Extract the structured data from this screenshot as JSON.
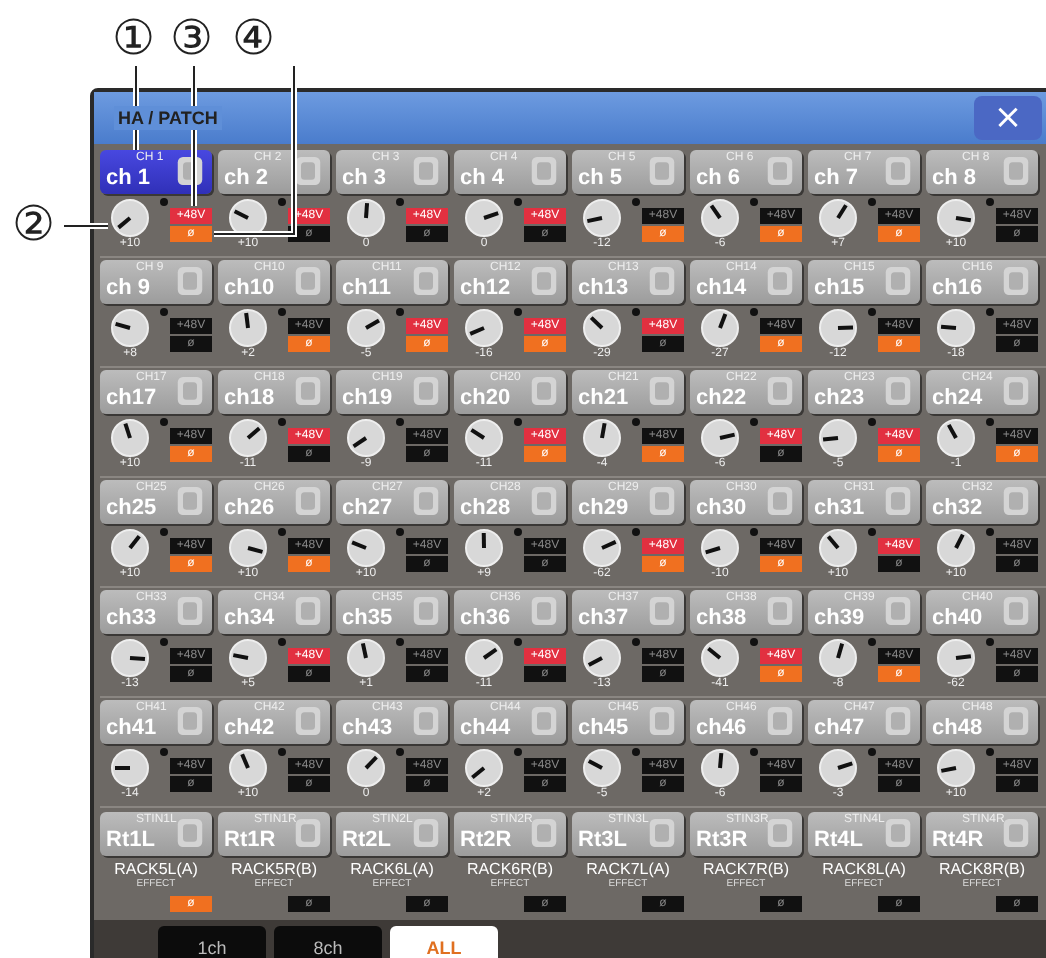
{
  "callouts": [
    {
      "label": "①"
    },
    {
      "label": "②"
    },
    {
      "label": "③"
    },
    {
      "label": "④"
    }
  ],
  "window": {
    "title": "HA / PATCH",
    "close": "×"
  },
  "groups": [
    {
      "channels": [
        {
          "label": "CH 1",
          "name": "ch 1",
          "selected": true,
          "gain": "+10",
          "phantom": true,
          "phantom_label": "+48V",
          "phase": true,
          "phase_label": "ø"
        },
        {
          "label": "CH 2",
          "name": "ch 2",
          "selected": false,
          "gain": "+10",
          "phantom": true,
          "phantom_label": "+48V",
          "phase": false,
          "phase_label": "ø"
        },
        {
          "label": "CH 3",
          "name": "ch 3",
          "selected": false,
          "gain": "0",
          "phantom": true,
          "phantom_label": "+48V",
          "phase": false,
          "phase_label": "ø"
        },
        {
          "label": "CH 4",
          "name": "ch 4",
          "selected": false,
          "gain": "0",
          "phantom": true,
          "phantom_label": "+48V",
          "phase": false,
          "phase_label": "ø"
        },
        {
          "label": "CH 5",
          "name": "ch 5",
          "selected": false,
          "gain": "-12",
          "phantom": false,
          "phantom_label": "+48V",
          "phase": true,
          "phase_label": "ø"
        },
        {
          "label": "CH 6",
          "name": "ch 6",
          "selected": false,
          "gain": "-6",
          "phantom": false,
          "phantom_label": "+48V",
          "phase": true,
          "phase_label": "ø"
        },
        {
          "label": "CH 7",
          "name": "ch 7",
          "selected": false,
          "gain": "+7",
          "phantom": false,
          "phantom_label": "+48V",
          "phase": true,
          "phase_label": "ø"
        },
        {
          "label": "CH 8",
          "name": "ch 8",
          "selected": false,
          "gain": "+10",
          "phantom": false,
          "phantom_label": "+48V",
          "phase": false,
          "phase_label": "ø"
        }
      ]
    },
    {
      "channels": [
        {
          "label": "CH 9",
          "name": "ch 9",
          "selected": false,
          "gain": "+8",
          "phantom": false,
          "phantom_label": "+48V",
          "phase": false,
          "phase_label": "ø"
        },
        {
          "label": "CH10",
          "name": "ch10",
          "selected": false,
          "gain": "+2",
          "phantom": false,
          "phantom_label": "+48V",
          "phase": true,
          "phase_label": "ø"
        },
        {
          "label": "CH11",
          "name": "ch11",
          "selected": false,
          "gain": "-5",
          "phantom": true,
          "phantom_label": "+48V",
          "phase": true,
          "phase_label": "ø"
        },
        {
          "label": "CH12",
          "name": "ch12",
          "selected": false,
          "gain": "-16",
          "phantom": true,
          "phantom_label": "+48V",
          "phase": true,
          "phase_label": "ø"
        },
        {
          "label": "CH13",
          "name": "ch13",
          "selected": false,
          "gain": "-29",
          "phantom": true,
          "phantom_label": "+48V",
          "phase": false,
          "phase_label": "ø"
        },
        {
          "label": "CH14",
          "name": "ch14",
          "selected": false,
          "gain": "-27",
          "phantom": false,
          "phantom_label": "+48V",
          "phase": true,
          "phase_label": "ø"
        },
        {
          "label": "CH15",
          "name": "ch15",
          "selected": false,
          "gain": "-12",
          "phantom": false,
          "phantom_label": "+48V",
          "phase": true,
          "phase_label": "ø"
        },
        {
          "label": "CH16",
          "name": "ch16",
          "selected": false,
          "gain": "-18",
          "phantom": false,
          "phantom_label": "+48V",
          "phase": false,
          "phase_label": "ø"
        }
      ]
    },
    {
      "channels": [
        {
          "label": "CH17",
          "name": "ch17",
          "selected": false,
          "gain": "+10",
          "phantom": false,
          "phantom_label": "+48V",
          "phase": true,
          "phase_label": "ø"
        },
        {
          "label": "CH18",
          "name": "ch18",
          "selected": false,
          "gain": "-11",
          "phantom": true,
          "phantom_label": "+48V",
          "phase": false,
          "phase_label": "ø"
        },
        {
          "label": "CH19",
          "name": "ch19",
          "selected": false,
          "gain": "-9",
          "phantom": false,
          "phantom_label": "+48V",
          "phase": false,
          "phase_label": "ø"
        },
        {
          "label": "CH20",
          "name": "ch20",
          "selected": false,
          "gain": "-11",
          "phantom": true,
          "phantom_label": "+48V",
          "phase": true,
          "phase_label": "ø"
        },
        {
          "label": "CH21",
          "name": "ch21",
          "selected": false,
          "gain": "-4",
          "phantom": false,
          "phantom_label": "+48V",
          "phase": true,
          "phase_label": "ø"
        },
        {
          "label": "CH22",
          "name": "ch22",
          "selected": false,
          "gain": "-6",
          "phantom": true,
          "phantom_label": "+48V",
          "phase": false,
          "phase_label": "ø"
        },
        {
          "label": "CH23",
          "name": "ch23",
          "selected": false,
          "gain": "-5",
          "phantom": true,
          "phantom_label": "+48V",
          "phase": true,
          "phase_label": "ø"
        },
        {
          "label": "CH24",
          "name": "ch24",
          "selected": false,
          "gain": "-1",
          "phantom": false,
          "phantom_label": "+48V",
          "phase": true,
          "phase_label": "ø"
        }
      ]
    },
    {
      "channels": [
        {
          "label": "CH25",
          "name": "ch25",
          "selected": false,
          "gain": "+10",
          "phantom": false,
          "phantom_label": "+48V",
          "phase": true,
          "phase_label": "ø"
        },
        {
          "label": "CH26",
          "name": "ch26",
          "selected": false,
          "gain": "+10",
          "phantom": false,
          "phantom_label": "+48V",
          "phase": true,
          "phase_label": "ø"
        },
        {
          "label": "CH27",
          "name": "ch27",
          "selected": false,
          "gain": "+10",
          "phantom": false,
          "phantom_label": "+48V",
          "phase": false,
          "phase_label": "ø"
        },
        {
          "label": "CH28",
          "name": "ch28",
          "selected": false,
          "gain": "+9",
          "phantom": false,
          "phantom_label": "+48V",
          "phase": false,
          "phase_label": "ø"
        },
        {
          "label": "CH29",
          "name": "ch29",
          "selected": false,
          "gain": "-62",
          "phantom": true,
          "phantom_label": "+48V",
          "phase": true,
          "phase_label": "ø"
        },
        {
          "label": "CH30",
          "name": "ch30",
          "selected": false,
          "gain": "-10",
          "phantom": false,
          "phantom_label": "+48V",
          "phase": true,
          "phase_label": "ø"
        },
        {
          "label": "CH31",
          "name": "ch31",
          "selected": false,
          "gain": "+10",
          "phantom": true,
          "phantom_label": "+48V",
          "phase": false,
          "phase_label": "ø"
        },
        {
          "label": "CH32",
          "name": "ch32",
          "selected": false,
          "gain": "+10",
          "phantom": false,
          "phantom_label": "+48V",
          "phase": false,
          "phase_label": "ø"
        }
      ]
    },
    {
      "channels": [
        {
          "label": "CH33",
          "name": "ch33",
          "selected": false,
          "gain": "-13",
          "phantom": false,
          "phantom_label": "+48V",
          "phase": false,
          "phase_label": "ø"
        },
        {
          "label": "CH34",
          "name": "ch34",
          "selected": false,
          "gain": "+5",
          "phantom": true,
          "phantom_label": "+48V",
          "phase": false,
          "phase_label": "ø"
        },
        {
          "label": "CH35",
          "name": "ch35",
          "selected": false,
          "gain": "+1",
          "phantom": false,
          "phantom_label": "+48V",
          "phase": false,
          "phase_label": "ø"
        },
        {
          "label": "CH36",
          "name": "ch36",
          "selected": false,
          "gain": "-11",
          "phantom": true,
          "phantom_label": "+48V",
          "phase": false,
          "phase_label": "ø"
        },
        {
          "label": "CH37",
          "name": "ch37",
          "selected": false,
          "gain": "-13",
          "phantom": false,
          "phantom_label": "+48V",
          "phase": false,
          "phase_label": "ø"
        },
        {
          "label": "CH38",
          "name": "ch38",
          "selected": false,
          "gain": "-41",
          "phantom": true,
          "phantom_label": "+48V",
          "phase": true,
          "phase_label": "ø"
        },
        {
          "label": "CH39",
          "name": "ch39",
          "selected": false,
          "gain": "-8",
          "phantom": false,
          "phantom_label": "+48V",
          "phase": true,
          "phase_label": "ø"
        },
        {
          "label": "CH40",
          "name": "ch40",
          "selected": false,
          "gain": "-62",
          "phantom": false,
          "phantom_label": "+48V",
          "phase": false,
          "phase_label": "ø"
        }
      ]
    },
    {
      "channels": [
        {
          "label": "CH41",
          "name": "ch41",
          "selected": false,
          "gain": "-14",
          "phantom": false,
          "phantom_label": "+48V",
          "phase": false,
          "phase_label": "ø"
        },
        {
          "label": "CH42",
          "name": "ch42",
          "selected": false,
          "gain": "+10",
          "phantom": false,
          "phantom_label": "+48V",
          "phase": false,
          "phase_label": "ø"
        },
        {
          "label": "CH43",
          "name": "ch43",
          "selected": false,
          "gain": "0",
          "phantom": false,
          "phantom_label": "+48V",
          "phase": false,
          "phase_label": "ø"
        },
        {
          "label": "CH44",
          "name": "ch44",
          "selected": false,
          "gain": "+2",
          "phantom": false,
          "phantom_label": "+48V",
          "phase": false,
          "phase_label": "ø"
        },
        {
          "label": "CH45",
          "name": "ch45",
          "selected": false,
          "gain": "-5",
          "phantom": false,
          "phantom_label": "+48V",
          "phase": false,
          "phase_label": "ø"
        },
        {
          "label": "CH46",
          "name": "ch46",
          "selected": false,
          "gain": "-6",
          "phantom": false,
          "phantom_label": "+48V",
          "phase": false,
          "phase_label": "ø"
        },
        {
          "label": "CH47",
          "name": "ch47",
          "selected": false,
          "gain": "-3",
          "phantom": false,
          "phantom_label": "+48V",
          "phase": false,
          "phase_label": "ø"
        },
        {
          "label": "CH48",
          "name": "ch48",
          "selected": false,
          "gain": "+10",
          "phantom": false,
          "phantom_label": "+48V",
          "phase": false,
          "phase_label": "ø"
        }
      ]
    }
  ],
  "stereo_inputs": [
    {
      "label": "STIN1L",
      "name": "Rt1L",
      "selected": false,
      "rack": "RACK5L(A)",
      "type": "EFFECT",
      "phase": true,
      "phase_label": "ø"
    },
    {
      "label": "STIN1R",
      "name": "Rt1R",
      "selected": false,
      "rack": "RACK5R(B)",
      "type": "EFFECT",
      "phase": false,
      "phase_label": "ø"
    },
    {
      "label": "STIN2L",
      "name": "Rt2L",
      "selected": false,
      "rack": "RACK6L(A)",
      "type": "EFFECT",
      "phase": false,
      "phase_label": "ø"
    },
    {
      "label": "STIN2R",
      "name": "Rt2R",
      "selected": false,
      "rack": "RACK6R(B)",
      "type": "EFFECT",
      "phase": false,
      "phase_label": "ø"
    },
    {
      "label": "STIN3L",
      "name": "Rt3L",
      "selected": false,
      "rack": "RACK7L(A)",
      "type": "EFFECT",
      "phase": false,
      "phase_label": "ø"
    },
    {
      "label": "STIN3R",
      "name": "Rt3R",
      "selected": false,
      "rack": "RACK7R(B)",
      "type": "EFFECT",
      "phase": false,
      "phase_label": "ø"
    },
    {
      "label": "STIN4L",
      "name": "Rt4L",
      "selected": false,
      "rack": "RACK8L(A)",
      "type": "EFFECT",
      "phase": false,
      "phase_label": "ø"
    },
    {
      "label": "STIN4R",
      "name": "Rt4R",
      "selected": false,
      "rack": "RACK8R(B)",
      "type": "EFFECT",
      "phase": false,
      "phase_label": "ø"
    }
  ],
  "tabs": [
    {
      "label": "1ch",
      "selected": false
    },
    {
      "label": "8ch",
      "selected": false
    },
    {
      "label": "ALL",
      "selected": true
    }
  ]
}
